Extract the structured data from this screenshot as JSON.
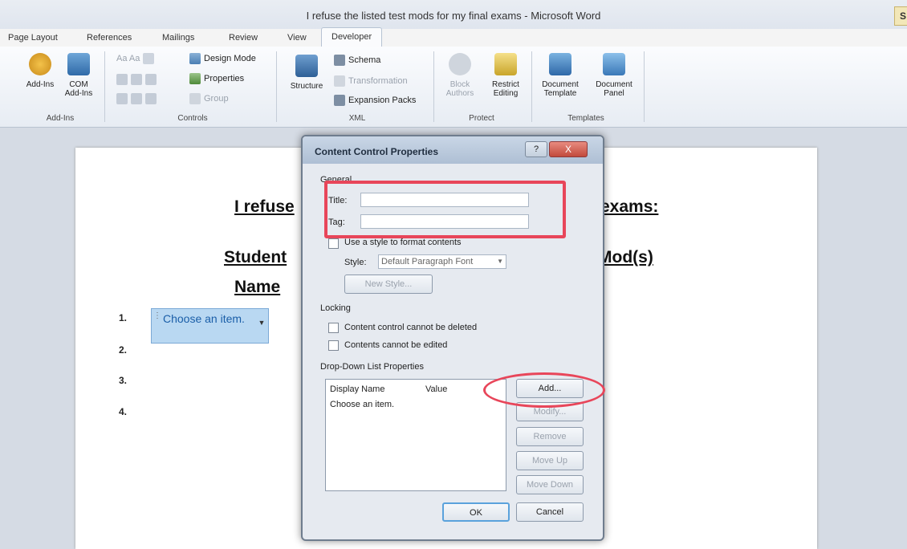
{
  "window": {
    "title": "I refuse the listed test mods for my final exams - Microsoft Word",
    "corner_badge": "S"
  },
  "tabs": [
    "Page Layout",
    "References",
    "Mailings",
    "Review",
    "View",
    "Developer"
  ],
  "ribbon": {
    "addins_group": {
      "label": "Add-Ins",
      "add_ins": "Add-Ins",
      "com_add_ins": "COM Add-Ins"
    },
    "controls_group": {
      "label": "Controls",
      "design_mode": "Design Mode",
      "properties": "Properties",
      "group": "Group",
      "aa": "Aa Aa"
    },
    "xml_group": {
      "label": "XML",
      "structure": "Structure",
      "schema": "Schema",
      "transformation": "Transformation",
      "expansion_packs": "Expansion Packs"
    },
    "protect_group": {
      "label": "Protect",
      "block_authors": "Block Authors",
      "restrict_editing": "Restrict Editing"
    },
    "templates_group": {
      "label": "Templates",
      "document_template": "Document Template",
      "document_panel": "Document Panel"
    }
  },
  "document": {
    "heading_left": "I refuse",
    "heading_right": "exams:",
    "col_student": "Student",
    "col_name": "Name",
    "col_mods": "Mod(s)",
    "numbers": [
      "1.",
      "2.",
      "3.",
      "4."
    ],
    "dropdown_text": "Choose an item."
  },
  "dialog": {
    "title": "Content Control Properties",
    "help": "?",
    "close": "X",
    "general": "General",
    "title_label": "Title:",
    "title_value": "",
    "tag_label": "Tag:",
    "tag_value": "",
    "use_style_label": "Use a style to format contents",
    "style_label": "Style:",
    "style_value": "Default Paragraph Font",
    "new_style": "New Style...",
    "locking": "Locking",
    "lock_delete": "Content control cannot be deleted",
    "lock_edit": "Contents cannot be edited",
    "ddl_props": "Drop-Down List Properties",
    "col_display": "Display Name",
    "col_value": "Value",
    "list_item": "Choose an item.",
    "btn_add": "Add...",
    "btn_modify": "Modify...",
    "btn_remove": "Remove",
    "btn_up": "Move Up",
    "btn_down": "Move Down",
    "btn_ok": "OK",
    "btn_cancel": "Cancel"
  },
  "colors": {
    "annotation": "#e8465a",
    "accent": "#5aa2dc"
  }
}
